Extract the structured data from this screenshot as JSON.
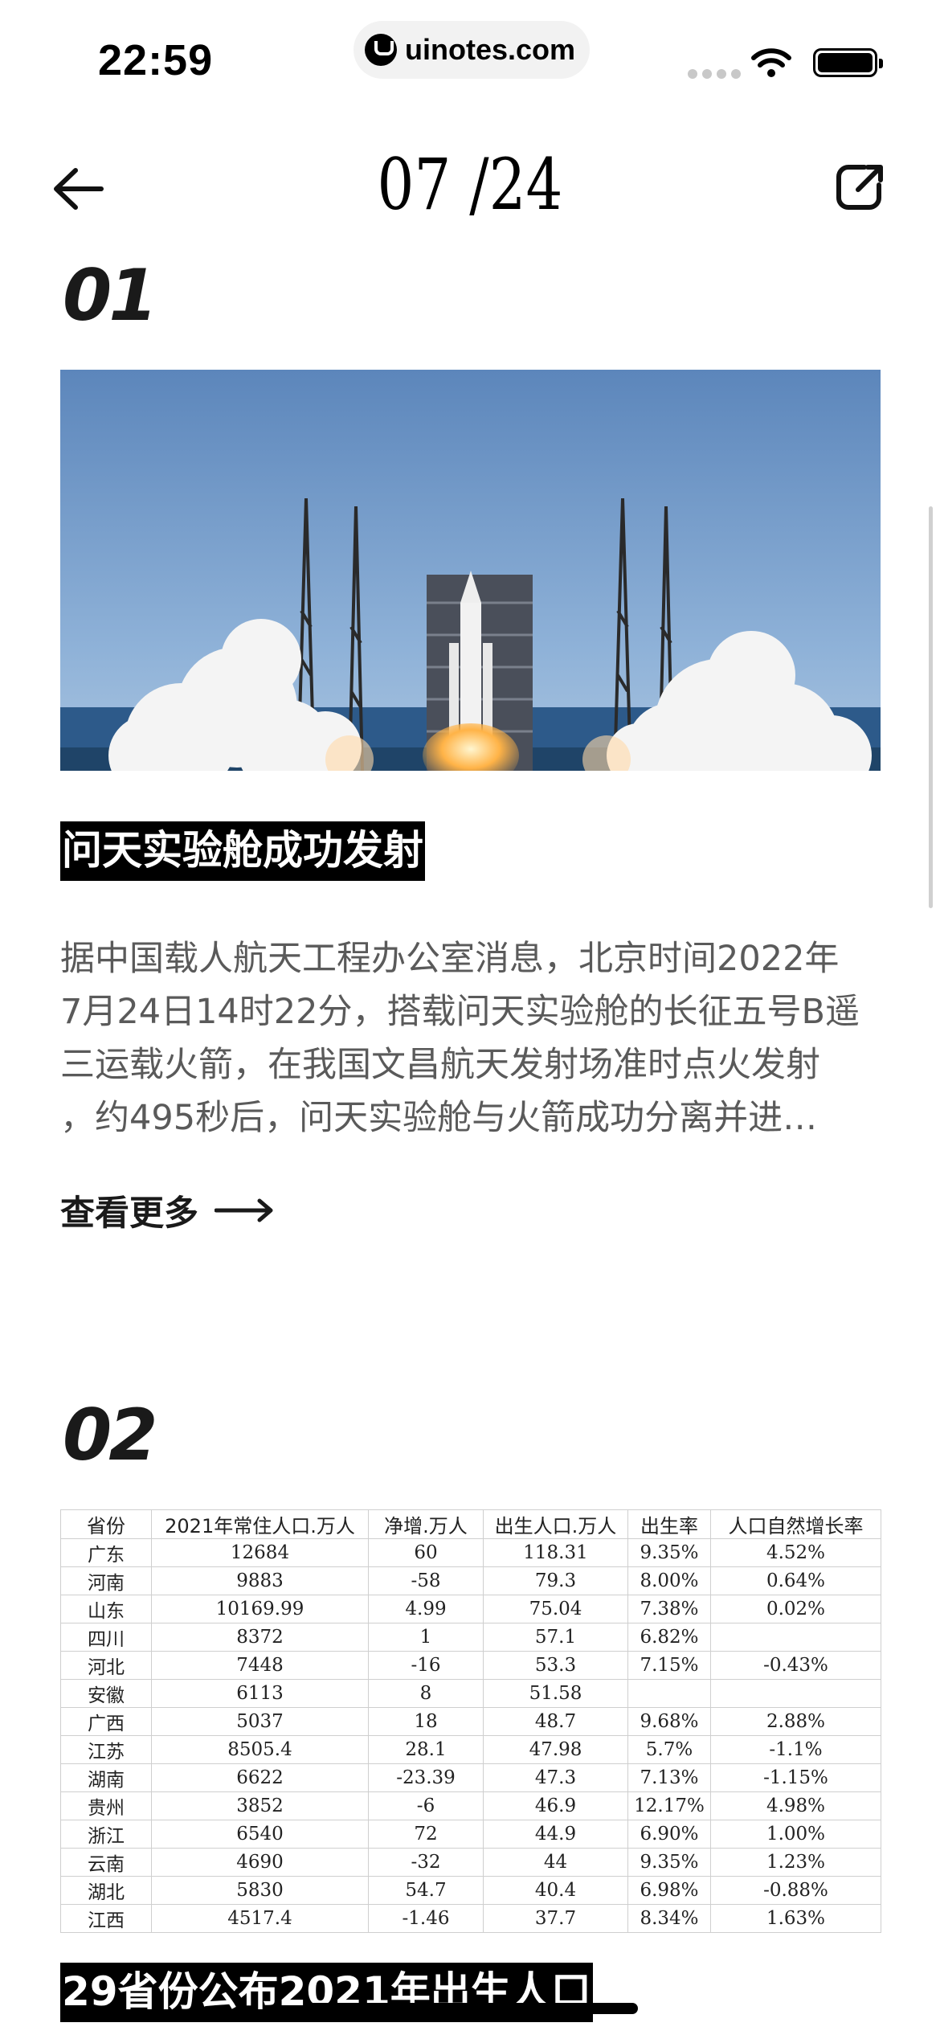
{
  "status_bar": {
    "time": "22:59",
    "url": "uinotes.com"
  },
  "nav": {
    "page_counter": "07 /24"
  },
  "articles": [
    {
      "number": "01",
      "title": "问天实验舱成功发射",
      "summary_lines": [
        "据中国载人航天工程办公室消息，北京时间2022年",
        "7月24日14时22分，搭载问天实验舱的长征五号B遥",
        "三运载火箭，在我国文昌航天发射场准时点火发射",
        "，约495秒后，问天实验舱与火箭成功分离并进…"
      ],
      "more_label": "查看更多"
    },
    {
      "number": "02",
      "title": "29省份公布2021年出生人口"
    }
  ],
  "population_table": {
    "headers": [
      "省份",
      "2021年常住人口.万人",
      "净增.万人",
      "出生人口.万人",
      "出生率",
      "人口自然增长率"
    ],
    "rows": [
      [
        "广东",
        "12684",
        "60",
        "118.31",
        "9.35%",
        "4.52%"
      ],
      [
        "河南",
        "9883",
        "-58",
        "79.3",
        "8.00%",
        "0.64%"
      ],
      [
        "山东",
        "10169.99",
        "4.99",
        "75.04",
        "7.38%",
        "0.02%"
      ],
      [
        "四川",
        "8372",
        "1",
        "57.1",
        "6.82%",
        ""
      ],
      [
        "河北",
        "7448",
        "-16",
        "53.3",
        "7.15%",
        "-0.43%"
      ],
      [
        "安徽",
        "6113",
        "8",
        "51.58",
        "",
        ""
      ],
      [
        "广西",
        "5037",
        "18",
        "48.7",
        "9.68%",
        "2.88%"
      ],
      [
        "江苏",
        "8505.4",
        "28.1",
        "47.98",
        "5.7%",
        "-1.1%"
      ],
      [
        "湖南",
        "6622",
        "-23.39",
        "47.3",
        "7.13%",
        "-1.15%"
      ],
      [
        "贵州",
        "3852",
        "-6",
        "46.9",
        "12.17%",
        "4.98%"
      ],
      [
        "浙江",
        "6540",
        "72",
        "44.9",
        "6.90%",
        "1.00%"
      ],
      [
        "云南",
        "4690",
        "-32",
        "44",
        "9.35%",
        "1.23%"
      ],
      [
        "湖北",
        "5830",
        "54.7",
        "40.4",
        "6.98%",
        "-0.88%"
      ],
      [
        "江西",
        "4517.4",
        "-1.46",
        "37.7",
        "8.34%",
        "1.63%"
      ]
    ]
  }
}
